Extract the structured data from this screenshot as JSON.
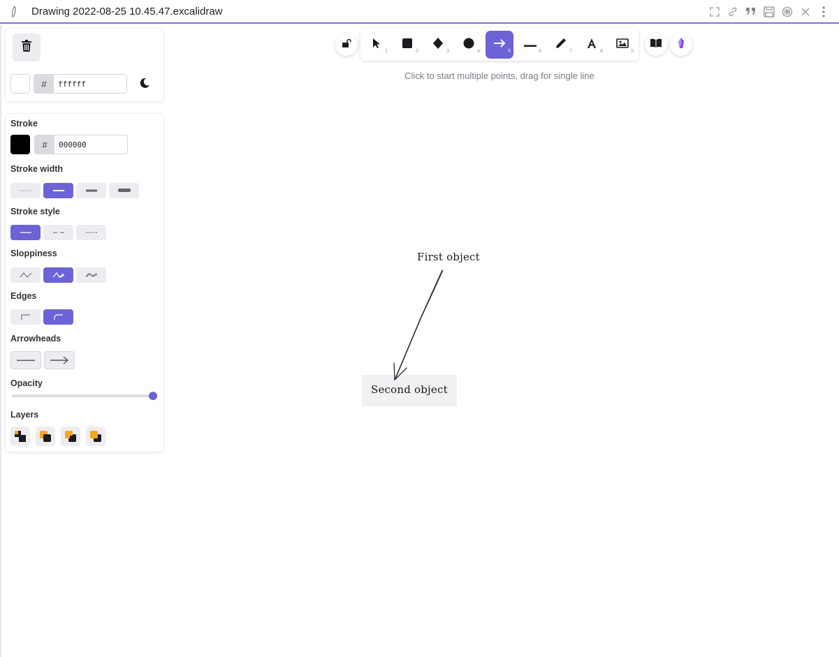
{
  "window": {
    "title": "Drawing 2022-08-25 10.45.47.excalidraw"
  },
  "canvas_bg": {
    "hex": "ffffff"
  },
  "stroke": {
    "label": "Stroke",
    "hex": "000000",
    "color": "#000000"
  },
  "sections": {
    "stroke_width": "Stroke width",
    "stroke_style": "Stroke style",
    "sloppiness": "Sloppiness",
    "edges": "Edges",
    "arrowheads": "Arrowheads",
    "opacity": "Opacity",
    "layers": "Layers"
  },
  "opacity_value": 100,
  "toolbar": {
    "tools": [
      {
        "name": "selection",
        "shortcut": "1"
      },
      {
        "name": "rectangle",
        "shortcut": "2"
      },
      {
        "name": "diamond",
        "shortcut": "3"
      },
      {
        "name": "ellipse",
        "shortcut": "4"
      },
      {
        "name": "arrow",
        "shortcut": "5",
        "active": true
      },
      {
        "name": "line",
        "shortcut": "6"
      },
      {
        "name": "draw",
        "shortcut": "7"
      },
      {
        "name": "text",
        "shortcut": "8"
      },
      {
        "name": "image",
        "shortcut": "9"
      }
    ]
  },
  "hint": "Click to start multiple points, drag for single line",
  "canvas": {
    "first_label": "First object",
    "second_label": "Second object"
  },
  "colors": {
    "accent": "#6c63d6",
    "layer_orange": "#f5a623"
  }
}
